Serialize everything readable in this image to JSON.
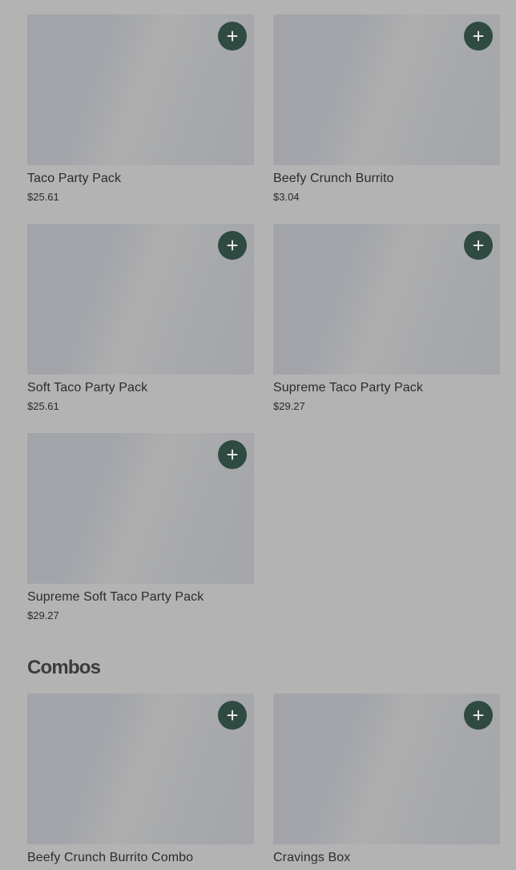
{
  "colors": {
    "overlay_background": "#b3b3b3",
    "add_button": "#2f4a40",
    "text": "#2c2c2c"
  },
  "top_products": [
    {
      "name": "Taco Party Pack",
      "price": "$25.61",
      "action_icon": "plus-icon"
    },
    {
      "name": "Beefy Crunch Burrito",
      "price": "$3.04",
      "action_icon": "plus-icon"
    },
    {
      "name": "Soft Taco Party Pack",
      "price": "$25.61",
      "action_icon": "plus-icon"
    },
    {
      "name": "Supreme Taco Party Pack",
      "price": "$29.27",
      "action_icon": "plus-icon"
    },
    {
      "name": "Supreme Soft Taco Party Pack",
      "price": "$29.27",
      "action_icon": "plus-icon"
    }
  ],
  "combos": {
    "title": "Combos",
    "products": [
      {
        "name": "Beefy Crunch Burrito Combo",
        "action_icon": "plus-icon"
      },
      {
        "name": "Cravings Box",
        "action_icon": "plus-icon"
      }
    ]
  }
}
